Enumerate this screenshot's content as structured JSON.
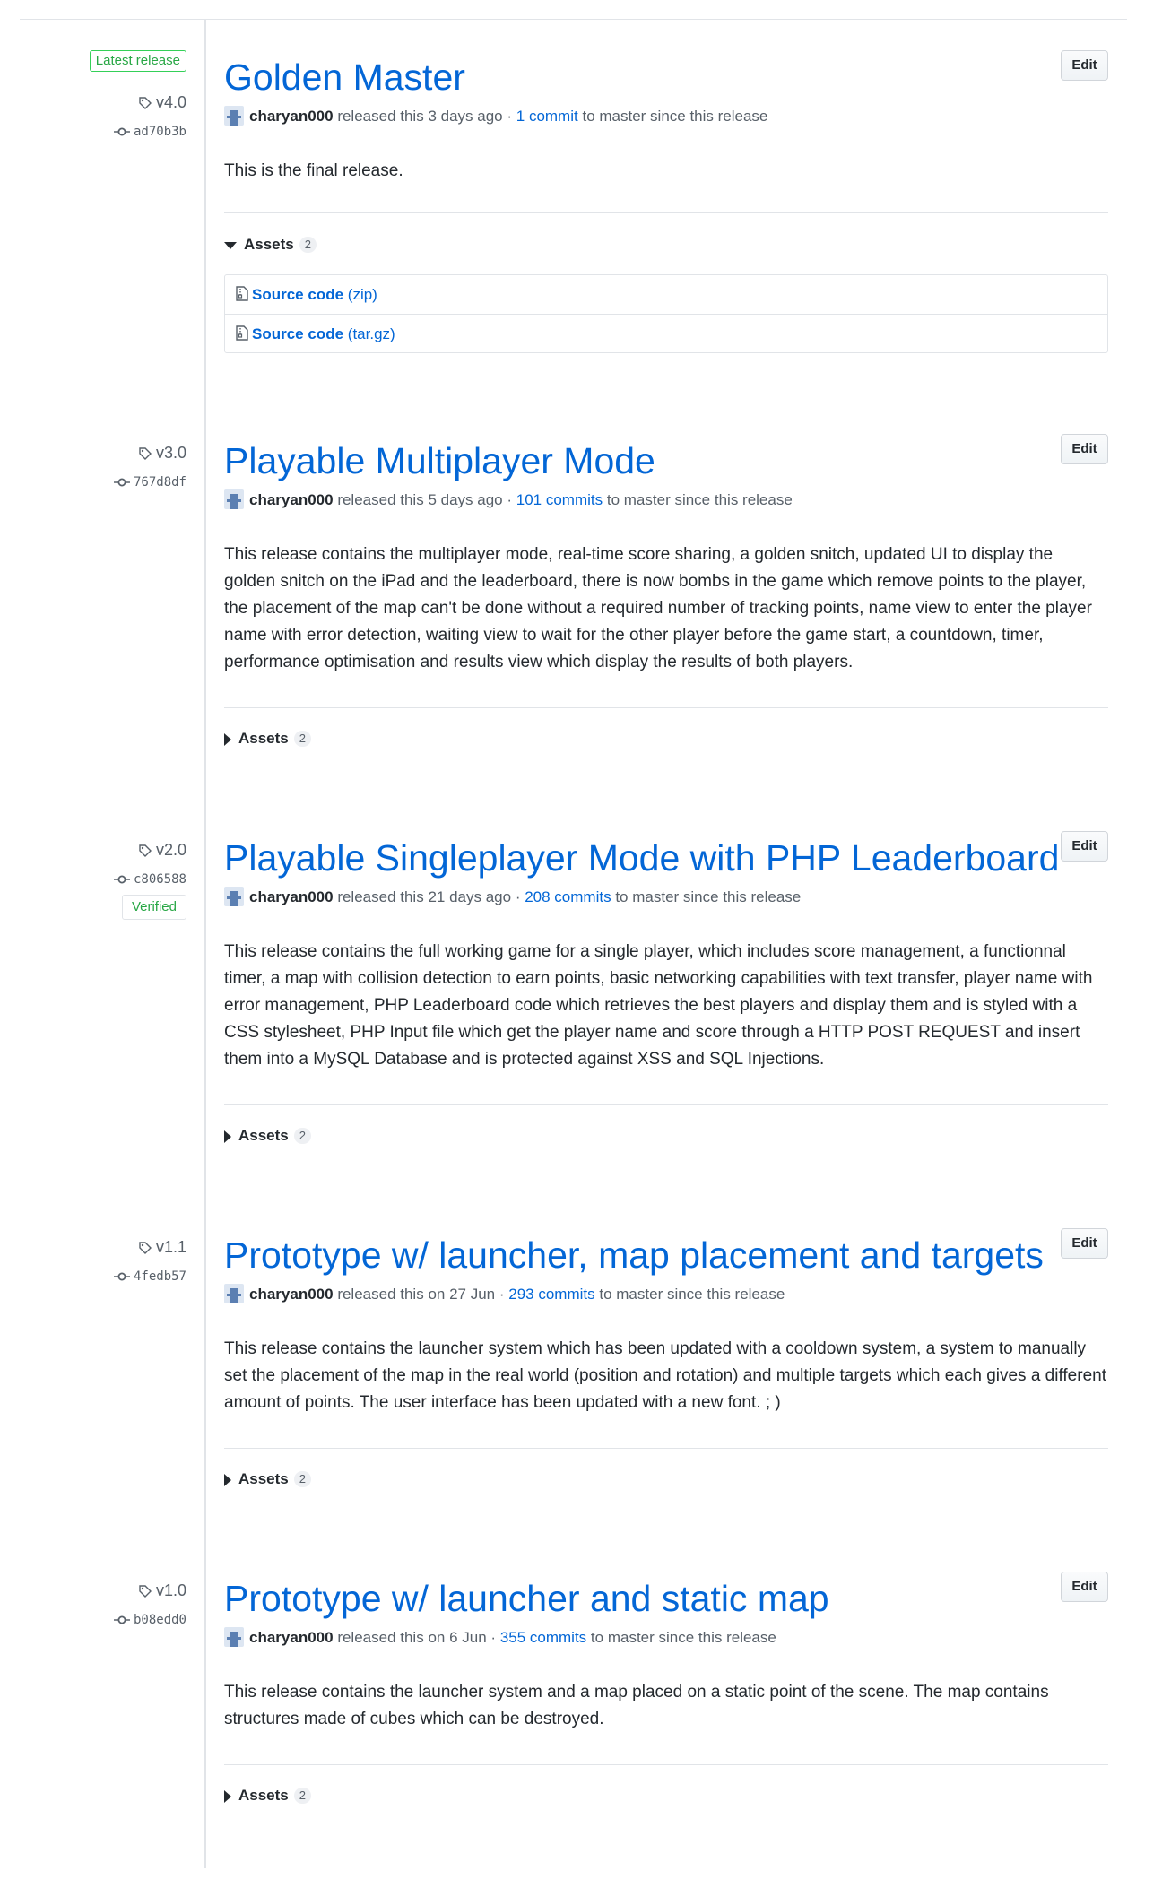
{
  "edit_label": "Edit",
  "assets_label": "Assets",
  "released_text": "released this",
  "to_master_text": "to master since this release",
  "separator": "·",
  "releases": [
    {
      "latest_badge": "Latest release",
      "tag": "v4.0",
      "commit": "ad70b3b",
      "title": "Golden Master",
      "author": "charyan000",
      "when": "3 days ago",
      "commits_link": "1 commit",
      "description": "This is the final release.",
      "assets_count": "2",
      "assets_expanded": true,
      "assets": [
        {
          "name": "Source code",
          "ext": "(zip)",
          "icon": "file-zip-icon"
        },
        {
          "name": "Source code",
          "ext": "(tar.gz)",
          "icon": "file-zip-icon"
        }
      ]
    },
    {
      "tag": "v3.0",
      "commit": "767d8df",
      "title": "Playable Multiplayer Mode",
      "author": "charyan000",
      "when": "5 days ago",
      "commits_link": "101 commits",
      "description": "This release contains the multiplayer mode, real-time score sharing, a golden snitch, updated UI to display the golden snitch on the iPad and the leaderboard, there is now bombs in the game which remove points to the player, the placement of the map can't be done without a required number of tracking points, name view to enter the player name with error detection, waiting view to wait for the other player before the game start, a countdown, timer, performance optimisation and results view which display the results of both players.",
      "assets_count": "2",
      "assets_expanded": false
    },
    {
      "tag": "v2.0",
      "commit": "c806588",
      "verified_badge": "Verified",
      "title": "Playable Singleplayer Mode with PHP Leaderboard",
      "author": "charyan000",
      "when": "21 days ago",
      "commits_link": "208 commits",
      "description": "This release contains the full working game for a single player, which includes score management, a functionnal timer, a map with collision detection to earn points, basic networking capabilities with text transfer, player name with error management, PHP Leaderboard code which retrieves the best players and display them and is styled with a CSS stylesheet, PHP Input file which get the player name and score through a HTTP POST REQUEST and insert them into a MySQL Database and is protected against XSS and SQL Injections.",
      "assets_count": "2",
      "assets_expanded": false
    },
    {
      "tag": "v1.1",
      "commit": "4fedb57",
      "title": "Prototype w/ launcher, map placement and targets",
      "author": "charyan000",
      "when": "on 27 Jun",
      "commits_link": "293 commits",
      "description": "This release contains the launcher system which has been updated with a cooldown system, a system to manually set the placement of the map in the real world (position and rotation) and multiple targets which each gives a different amount of points. The user interface has been updated with a new font. ; )",
      "assets_count": "2",
      "assets_expanded": false
    },
    {
      "tag": "v1.0",
      "commit": "b08edd0",
      "title": "Prototype w/ launcher and static map",
      "author": "charyan000",
      "when": "on 6 Jun",
      "commits_link": "355 commits",
      "description": "This release contains the launcher system and a map placed on a static point of the scene. The map contains structures made of cubes which can be destroyed.",
      "assets_count": "2",
      "assets_expanded": false
    }
  ]
}
